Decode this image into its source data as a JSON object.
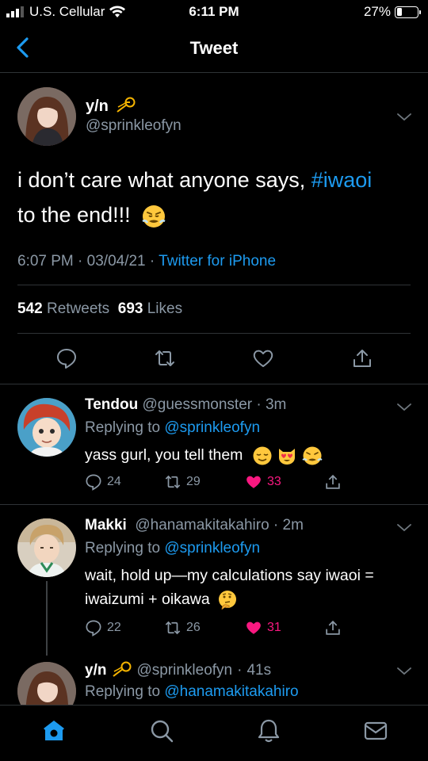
{
  "status_bar": {
    "carrier": "U.S. Cellular",
    "time": "6:11 PM",
    "battery": "27%",
    "battery_level": 0.27
  },
  "nav": {
    "title": "Tweet"
  },
  "main_tweet": {
    "name": "y/n",
    "handle": "@sprinkleofyn",
    "text_before": "i don’t care what anyone says, ",
    "hashtag": "#iwaoi",
    "text_after": "to the end!!!",
    "time": "6:07 PM",
    "date": "03/04/21",
    "source": "Twitter for iPhone",
    "sep": "·",
    "retweets": "542",
    "retweets_label": "Retweets",
    "likes": "693",
    "likes_label": "Likes"
  },
  "replies": [
    {
      "name": "Tendou",
      "handle": "@guessmonster",
      "age": "3m",
      "replying_to_label": "Replying to",
      "replying_to": "@sprinkleofyn",
      "text": "yass gurl, you tell them",
      "replies": "24",
      "retweets": "29",
      "likes": "33"
    },
    {
      "name": "Makki",
      "handle": "@hanamakitakahiro",
      "age": "2m",
      "replying_to_label": "Replying to",
      "replying_to": "@sprinkleofyn",
      "text": "wait, hold up—my calculations say iwaoi = iwaizumi + oikawa",
      "replies": "22",
      "retweets": "26",
      "likes": "31"
    },
    {
      "name": "y/n",
      "handle": "@sprinkleofyn",
      "age": "41s",
      "replying_to_label": "Replying to",
      "replying_to": "@hanamakitakahiro"
    }
  ],
  "colors": {
    "accent": "#1d9bf0",
    "like": "#f91880",
    "muted": "#8b98a5",
    "divider": "#2f3336"
  }
}
